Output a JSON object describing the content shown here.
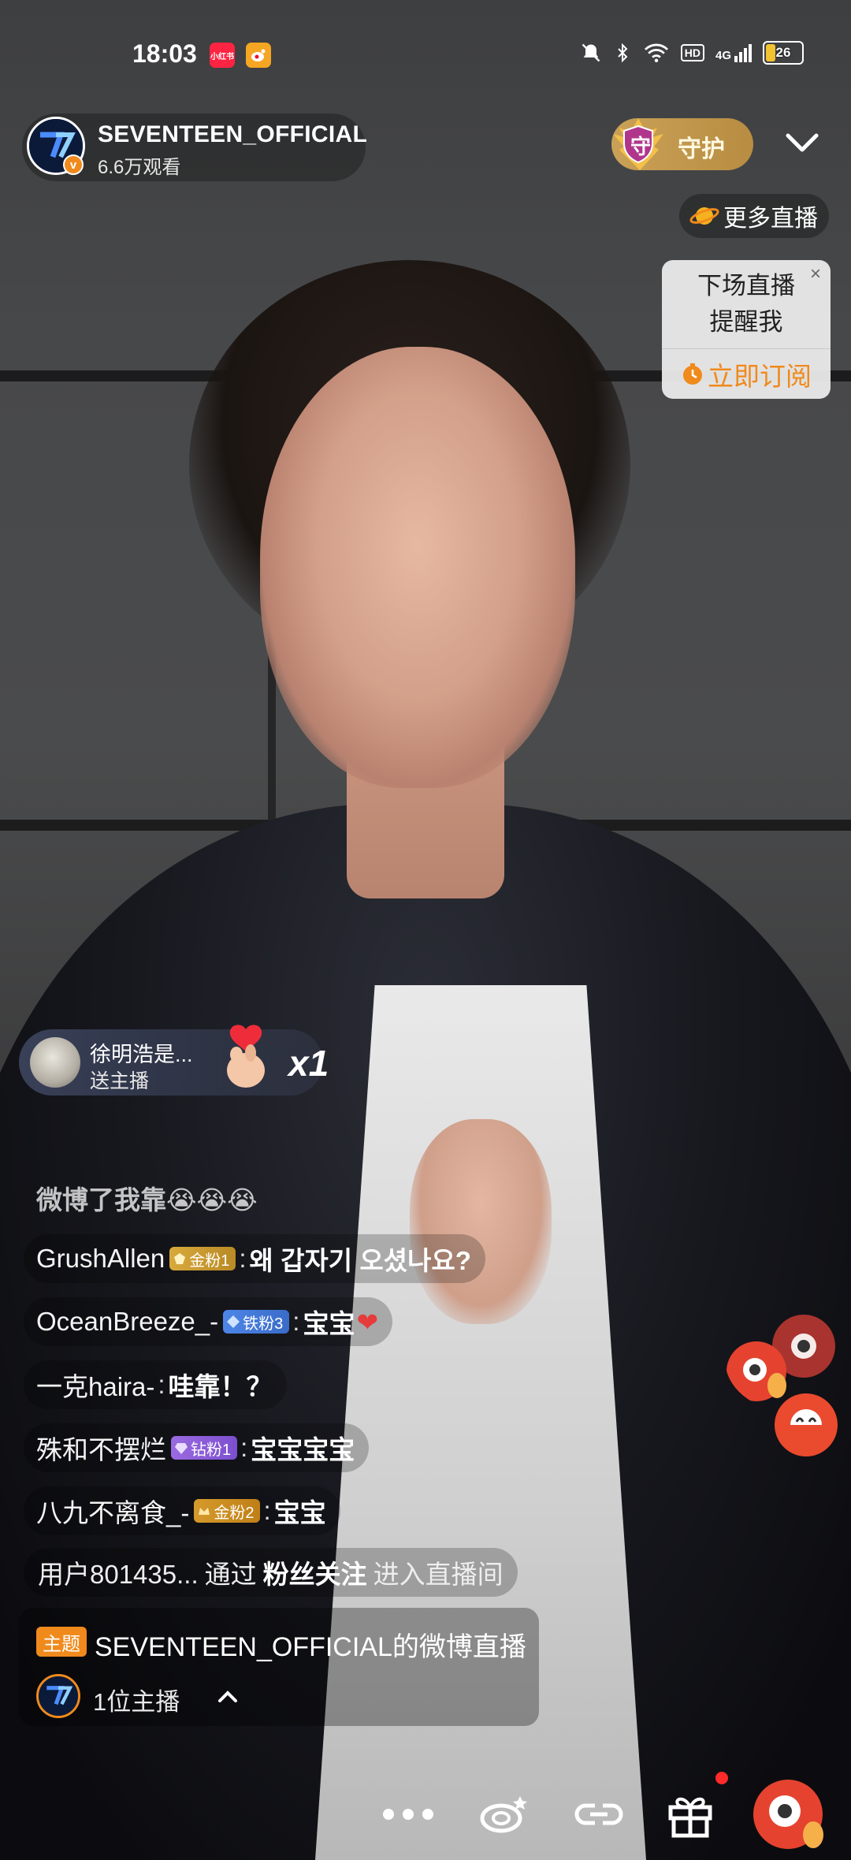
{
  "status_bar": {
    "time": "18:03",
    "app_icons": [
      "xiaohongshu-icon",
      "weibo-icon"
    ],
    "app_icon_labels": [
      "小红书",
      ""
    ],
    "icons": [
      "mute-icon",
      "bluetooth-icon",
      "wifi-icon",
      "hd-icon",
      "signal-4g-icon"
    ],
    "hd_label": "HD",
    "network_label": "4G",
    "battery": "26"
  },
  "host": {
    "name": "SEVENTEEN_OFFICIAL",
    "viewers": "6.6万观看",
    "verified_mark": "v"
  },
  "guard": {
    "shield_char": "守",
    "label": "守护"
  },
  "more_live": {
    "label": "更多直播"
  },
  "reminder": {
    "line1": "下场直播",
    "line2": "提醒我",
    "close": "×",
    "subscribe": "立即订阅"
  },
  "gift_banner": {
    "user": "徐明浩是...",
    "action": "送主播",
    "count": "x1"
  },
  "chat": {
    "faded": "微博了我靠😭😭😭",
    "messages": [
      {
        "user": "GrushAllen",
        "badge": "金粉1",
        "badge_style": "gold",
        "text": "왜 갑자기 오셨나요?"
      },
      {
        "user": "OceanBreeze_-",
        "badge": "铁粉3",
        "badge_style": "iron",
        "text": "宝宝",
        "heart": "❤"
      },
      {
        "user": "一克haira-",
        "badge": "",
        "badge_style": "",
        "text": "哇靠！？"
      },
      {
        "user": "殊和不摆烂",
        "badge": "钻粉1",
        "badge_style": "diamond",
        "text": "宝宝宝宝"
      },
      {
        "user": "八九不离食_-",
        "badge": "金粉2",
        "badge_style": "gold2",
        "text": "宝宝"
      }
    ],
    "system": {
      "user": "用户801435...",
      "via": "通过",
      "source": "粉丝关注",
      "enter": "进入直播间"
    }
  },
  "topic": {
    "tag": "主题",
    "title": "SEVENTEEN_OFFICIAL的微博直播",
    "hosts_label": "1位主播"
  },
  "toolbar": {
    "buttons": [
      "more-options-icon",
      "share-icon",
      "link-icon",
      "gift-icon",
      "weibo-mascot-icon"
    ]
  },
  "colors": {
    "accent_orange": "#f08a1c",
    "guard_gold": "#c9a157",
    "heart_red": "#e63b3b"
  }
}
